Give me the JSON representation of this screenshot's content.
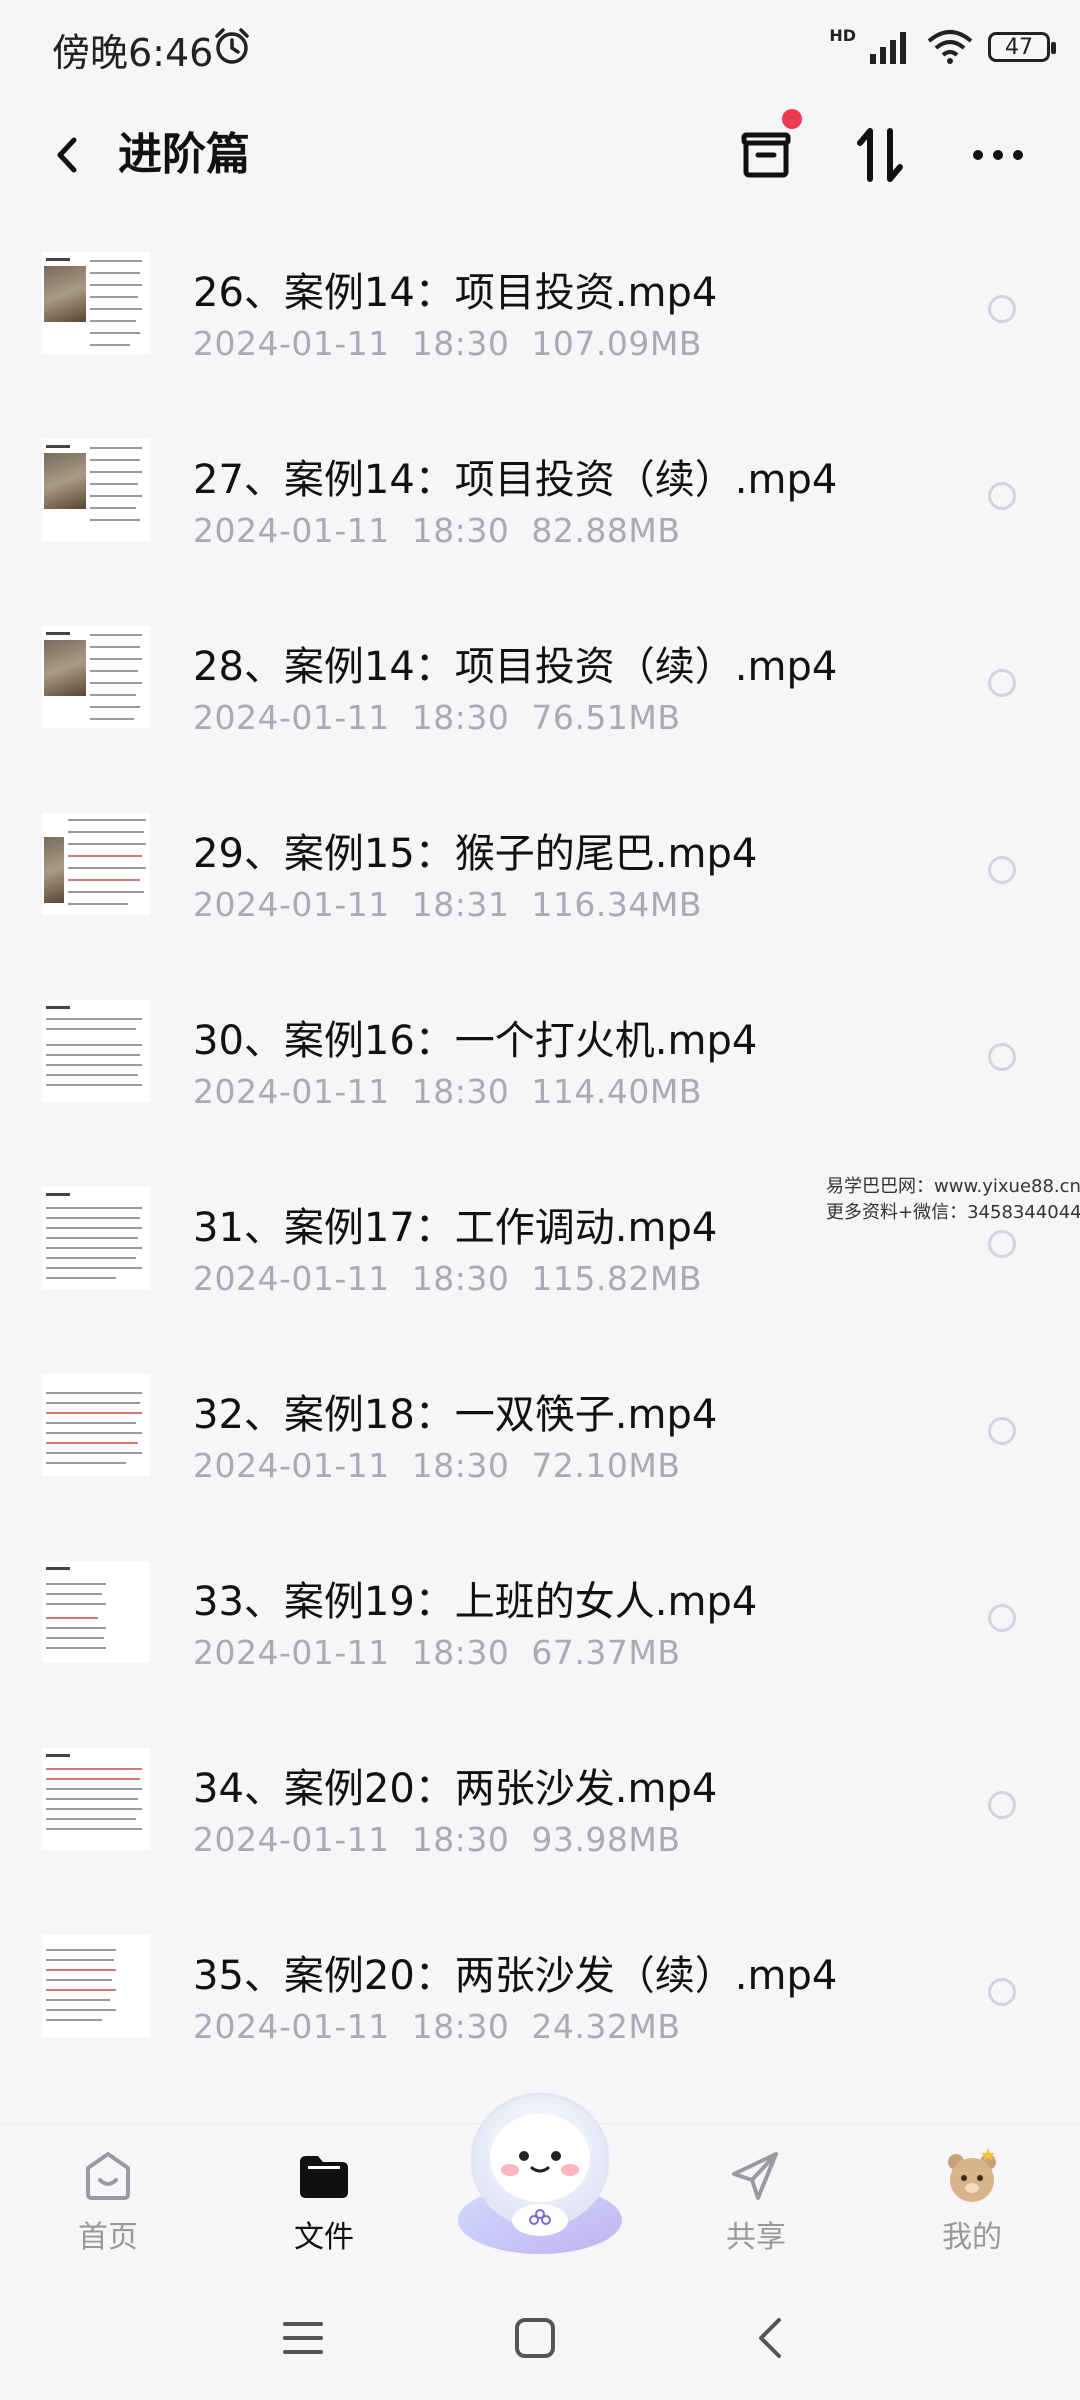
{
  "status": {
    "time": "傍晚6:46",
    "network": "HD",
    "battery": "47"
  },
  "header": {
    "title": "进阶篇"
  },
  "files": [
    {
      "name": "26、案例14：项目投资.mp4",
      "date": "2024-01-11",
      "time": "18:30",
      "size": "107.09MB"
    },
    {
      "name": "27、案例14：项目投资（续）.mp4",
      "date": "2024-01-11",
      "time": "18:30",
      "size": "82.88MB"
    },
    {
      "name": "28、案例14：项目投资（续）.mp4",
      "date": "2024-01-11",
      "time": "18:30",
      "size": "76.51MB"
    },
    {
      "name": "29、案例15：猴子的尾巴.mp4",
      "date": "2024-01-11",
      "time": "18:31",
      "size": "116.34MB"
    },
    {
      "name": "30、案例16：一个打火机.mp4",
      "date": "2024-01-11",
      "time": "18:30",
      "size": "114.40MB"
    },
    {
      "name": "31、案例17：工作调动.mp4",
      "date": "2024-01-11",
      "time": "18:30",
      "size": "115.82MB"
    },
    {
      "name": "32、案例18：一双筷子.mp4",
      "date": "2024-01-11",
      "time": "18:30",
      "size": "72.10MB"
    },
    {
      "name": "33、案例19：上班的女人.mp4",
      "date": "2024-01-11",
      "time": "18:30",
      "size": "67.37MB"
    },
    {
      "name": "34、案例20：两张沙发.mp4",
      "date": "2024-01-11",
      "time": "18:30",
      "size": "93.98MB"
    },
    {
      "name": "35、案例20：两张沙发（续）.mp4",
      "date": "2024-01-11",
      "time": "18:30",
      "size": "24.32MB"
    }
  ],
  "watermark": {
    "line1": "易学巴巴网：www.yixue88.cn",
    "line2": "更多资料+微信：3458344044"
  },
  "nav": {
    "home": "首页",
    "files": "文件",
    "share": "共享",
    "mine": "我的"
  },
  "colors": {
    "accent": "#ec3a52",
    "meta_text": "#a9abb2",
    "background": "#f6f6f8"
  }
}
